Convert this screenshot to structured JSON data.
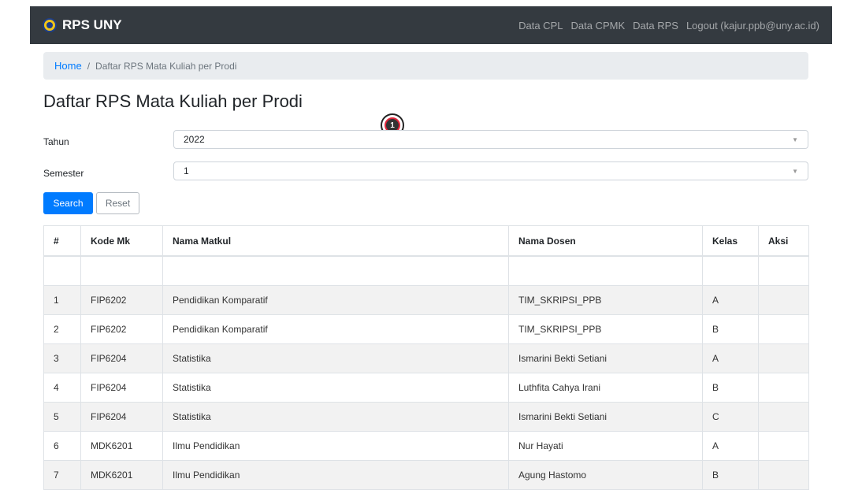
{
  "navbar": {
    "brand": "RPS UNY",
    "links": [
      "Data CPL",
      "Data CPMK",
      "Data RPS",
      "Logout (kajur.ppb@uny.ac.id)"
    ]
  },
  "breadcrumb": {
    "home": "Home",
    "separator": "/",
    "current": "Daftar RPS Mata Kuliah per Prodi"
  },
  "page_title": "Daftar RPS Mata Kuliah per Prodi",
  "marker": "1",
  "filters": {
    "tahun_label": "Tahun",
    "tahun_value": "2022",
    "semester_label": "Semester",
    "semester_value": "1"
  },
  "buttons": {
    "search": "Search",
    "reset": "Reset"
  },
  "table": {
    "headers": [
      "#",
      "Kode Mk",
      "Nama Matkul",
      "Nama Dosen",
      "Kelas",
      "Aksi"
    ],
    "rows": [
      [
        "1",
        "FIP6202",
        "Pendidikan Komparatif",
        "TIM_SKRIPSI_PPB",
        "A",
        ""
      ],
      [
        "2",
        "FIP6202",
        "Pendidikan Komparatif",
        "TIM_SKRIPSI_PPB",
        "B",
        ""
      ],
      [
        "3",
        "FIP6204",
        "Statistika",
        "Ismarini Bekti Setiani",
        "A",
        ""
      ],
      [
        "4",
        "FIP6204",
        "Statistika",
        "Luthfita Cahya Irani",
        "B",
        ""
      ],
      [
        "5",
        "FIP6204",
        "Statistika",
        "Ismarini Bekti Setiani",
        "C",
        ""
      ],
      [
        "6",
        "MDK6201",
        "Ilmu Pendidikan",
        "Nur Hayati",
        "A",
        ""
      ],
      [
        "7",
        "MDK6201",
        "Ilmu Pendidikan",
        "Agung Hastomo",
        "B",
        ""
      ]
    ]
  },
  "colors": {
    "navbar": "#343a40",
    "primary": "#007bff",
    "breadcrumb_bg": "#e9ecef",
    "stripe": "#f2f2f2"
  }
}
